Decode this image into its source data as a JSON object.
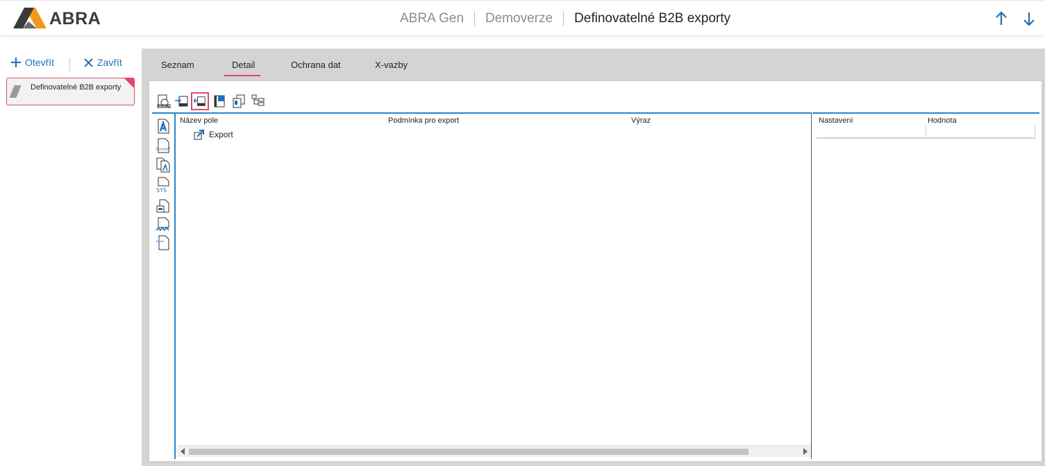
{
  "header": {
    "logo_text": "ABRA",
    "breadcrumb": {
      "app": "ABRA Gen",
      "database": "Demoverze",
      "current": "Definovatelné B2B exporty"
    },
    "colors": {
      "accent": "#1e6fb8",
      "highlight": "#e3456a",
      "logo_dark": "#3a3a3a",
      "logo_orange": "#f29a1f"
    }
  },
  "left_panel": {
    "open_label": "Otevřít",
    "close_label": "Zavřít",
    "open_document": "Definovatelné B2B exporty"
  },
  "tabs": [
    {
      "label": "Seznam",
      "active": false
    },
    {
      "label": "Detail",
      "active": true
    },
    {
      "label": "Ochrana dat",
      "active": false
    },
    {
      "label": "X-vazby",
      "active": false
    }
  ],
  "toolbar": {
    "buttons": [
      {
        "icon": "tree-view-icon"
      },
      {
        "icon": "move-in-icon"
      },
      {
        "icon": "move-out-icon",
        "highlighted": true
      },
      {
        "icon": "bookmark-page-icon"
      },
      {
        "icon": "copy-pages-icon"
      },
      {
        "icon": "tree-structure-icon"
      }
    ]
  },
  "side_tools": [
    {
      "icon": "text-field-icon"
    },
    {
      "icon": "formula-icon"
    },
    {
      "icon": "nested-text-icon"
    },
    {
      "icon": "sys-field-icon"
    },
    {
      "icon": "sub-record-icon"
    },
    {
      "icon": "expression-icon"
    },
    {
      "icon": "page-link-icon"
    }
  ],
  "grid": {
    "columns": [
      "Název pole",
      "Podmínka pro export",
      "Výraz"
    ],
    "rows": [
      {
        "name": "Export",
        "icon": "export-arrow-icon"
      }
    ]
  },
  "settings": {
    "columns": [
      "Nastavení",
      "Hodnota"
    ]
  }
}
